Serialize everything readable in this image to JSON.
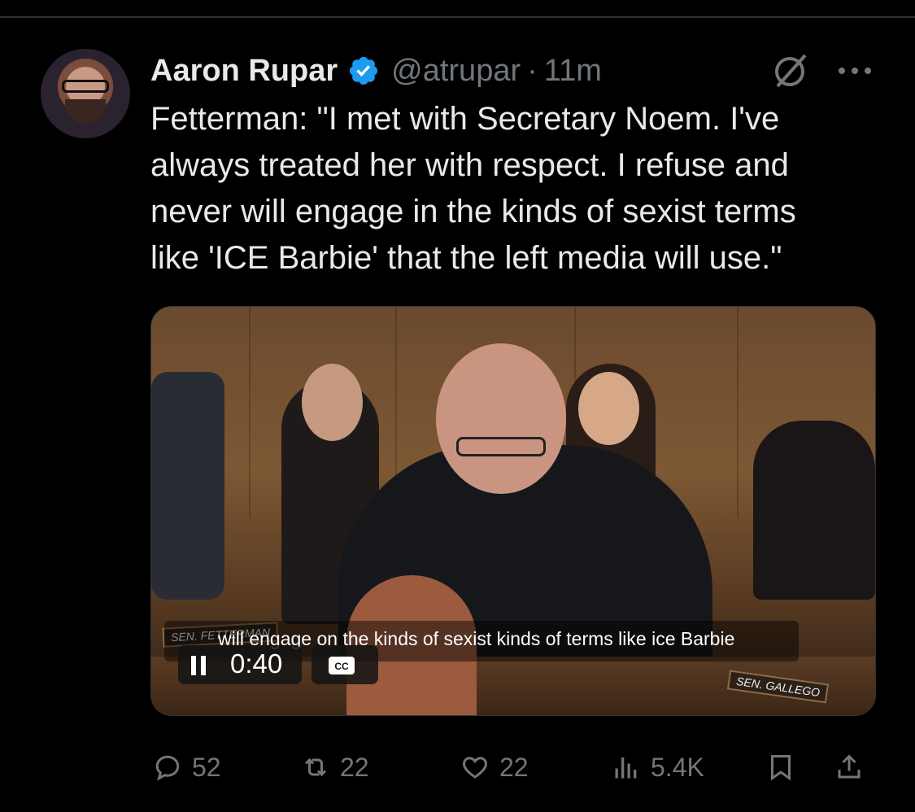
{
  "tweet": {
    "author_name": "Aaron Rupar",
    "handle": "@atrupar",
    "separator": "·",
    "time": "11m",
    "text_lines": [
      "Fetterman: \"I met with Secretary Noem. I've",
      "always treated her with respect. I refuse and",
      "never will engage in the kinds of sexist terms",
      "like 'ICE Barbie' that the left media will use.\""
    ]
  },
  "video": {
    "caption": "will engage on the kinds of sexist kinds of terms like ice Barbie",
    "time": "0:40",
    "cc_label": "CC",
    "nameplate_left": "SEN. FETTERMAN",
    "nameplate_right": "SEN. GALLEGO",
    "state": "playing"
  },
  "actions": {
    "replies": "52",
    "reposts": "22",
    "likes": "22",
    "views": "5.4K"
  },
  "icons": {
    "verified": "verified-badge-icon",
    "grok": "grok-icon",
    "more": "more-icon",
    "pause": "pause-icon",
    "cc": "closed-captions-icon",
    "reply": "reply-icon",
    "repost": "repost-icon",
    "like": "heart-icon",
    "views": "views-icon",
    "bookmark": "bookmark-icon",
    "share": "share-icon"
  },
  "colors": {
    "background": "#000000",
    "text": "#e7e9ea",
    "secondary": "#71767b",
    "verified": "#1d9bf0"
  }
}
